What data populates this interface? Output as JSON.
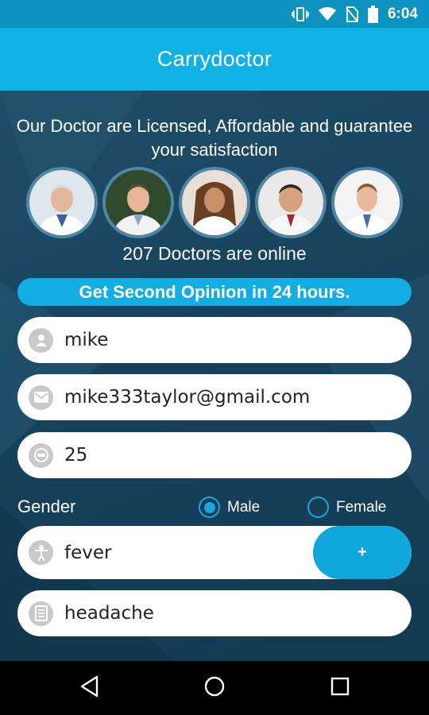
{
  "status_bar": {
    "time": "6:04",
    "icons": [
      "vibrate-icon",
      "wifi-icon",
      "no-sim-icon",
      "battery-icon"
    ]
  },
  "app_bar": {
    "title": "Carrydoctor"
  },
  "intro": {
    "tagline": "Our Doctor  are Licensed, Affordable and guarantee your satisfaction",
    "doctors_online": "207 Doctors are online",
    "banner": "Get Second Opinion in 24 hours."
  },
  "form": {
    "name": {
      "value": "mike",
      "icon": "person-icon"
    },
    "email": {
      "value": "mike333taylor@gmail.com",
      "icon": "email-icon"
    },
    "age": {
      "value": "25",
      "icon": "age-icon"
    },
    "gender": {
      "label": "Gender",
      "options": [
        {
          "label": "Male",
          "selected": true
        },
        {
          "label": "Female",
          "selected": false
        }
      ]
    },
    "symptom": {
      "value": "fever",
      "icon": "body-icon",
      "add_label": "+"
    },
    "notes": {
      "value": "headache",
      "icon": "document-icon"
    }
  },
  "nav_bar": {
    "icons": [
      "back-icon",
      "home-icon",
      "recents-icon"
    ]
  },
  "colors": {
    "status_bar": "#0c93bf",
    "app_bar": "#10b1e5",
    "accent": "#12ade3",
    "background": "#1c4a64"
  }
}
